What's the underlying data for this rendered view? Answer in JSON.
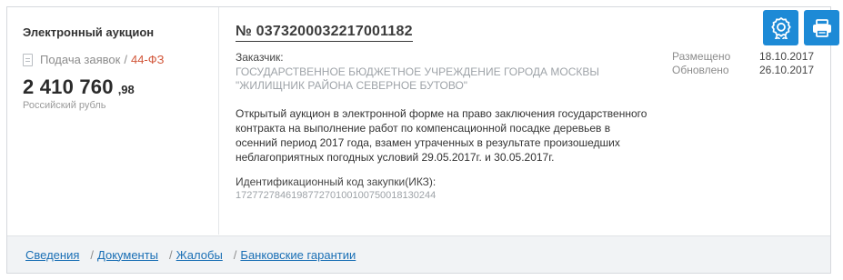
{
  "auction": {
    "type": "Электронный аукцион",
    "status": "Подача заявок",
    "separator": "/",
    "law": "44-ФЗ",
    "price_main": "2 410 760",
    "price_cents": ",98",
    "currency": "Российский рубль"
  },
  "purchase": {
    "number": "№ 0373200032217001182",
    "customer_label": "Заказчик:",
    "customer_name": "ГОСУДАРСТВЕННОЕ БЮДЖЕТНОЕ УЧРЕЖДЕНИЕ ГОРОДА МОСКВЫ \"ЖИЛИЩНИК РАЙОНА СЕВЕРНОЕ БУТОВО\"",
    "description": "Открытый аукцион в электронной форме на право заключения государственного контракта на выполнение работ по компенсационной посадке деревьев в осенний период 2017 года, взамен утраченных в результате произошедших неблагоприятных погодных условий 29.05.2017г. и 30.05.2017г.",
    "ikz_label": "Идентификационный код закупки(ИКЗ):",
    "ikz_value": "172772784619877270100100750018130244"
  },
  "dates": {
    "posted_label": "Размещено",
    "posted_value": "18.10.2017",
    "updated_label": "Обновлено",
    "updated_value": "26.10.2017"
  },
  "actions": {
    "certificate_icon": "certificate-icon",
    "print_icon": "print-icon",
    "accent_color": "#1d8ad6"
  },
  "links": {
    "info": "Сведения",
    "documents": "Документы",
    "complaints": "Жалобы",
    "guarantees": "Банковские гарантии",
    "separator": "/"
  }
}
